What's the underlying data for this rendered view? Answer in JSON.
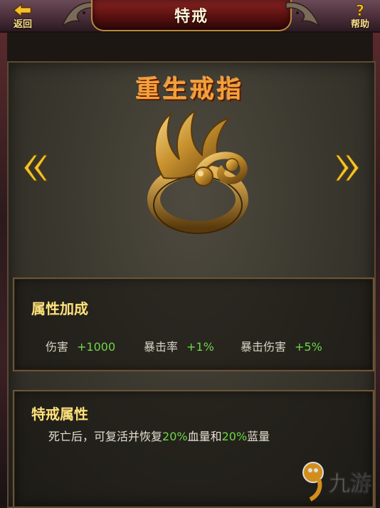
{
  "header": {
    "title": "特戒",
    "back_label": "返回",
    "help_label": "帮助"
  },
  "item": {
    "name": "重生戒指",
    "image": "golden-ring"
  },
  "attribute_bonus": {
    "title": "属性加成",
    "stats": [
      {
        "label": "伤害",
        "value": "+1000"
      },
      {
        "label": "暴击率",
        "value": "+1%"
      },
      {
        "label": "暴击伤害",
        "value": "+5%"
      }
    ]
  },
  "special_attribute": {
    "title": "特戒属性",
    "desc_part1": "死亡后，可复活并恢复",
    "desc_hp_pct": "20%",
    "desc_part2": "血量和",
    "desc_mp_pct": "20%",
    "desc_part3": "蓝量"
  },
  "watermark": {
    "text": "九游"
  },
  "colors": {
    "accent_gold": "#ffe27a",
    "value_green": "#6fd64a",
    "title_orange": "#f3a13a"
  }
}
